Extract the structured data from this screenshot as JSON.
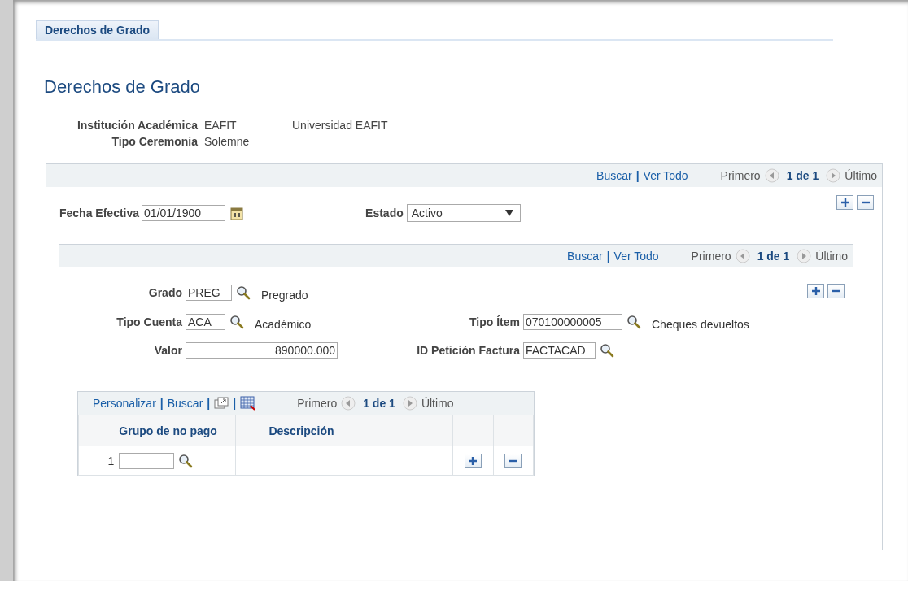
{
  "tab": {
    "label": "Derechos de Grado",
    "selected": true
  },
  "page_title": "Derechos de Grado",
  "header_fields": [
    {
      "label": "Institución Académica",
      "value": "EAFIT",
      "description": "Universidad EAFIT"
    },
    {
      "label": "Tipo Ceremonia",
      "value": "Solemne"
    }
  ],
  "outer_section": {
    "nav": {
      "links": [
        "Buscar",
        "Ver Todo"
      ],
      "separator": "|",
      "first": "Primero",
      "count": "1 de 1",
      "last": "Último"
    },
    "effective_date": {
      "label": "Fecha Efectiva",
      "value": "01/01/1900"
    },
    "status": {
      "label": "Estado",
      "value": "Activo"
    }
  },
  "inner_section": {
    "nav": {
      "links": [
        "Buscar",
        "Ver Todo"
      ],
      "separator": "|",
      "first": "Primero",
      "count": "1 de 1",
      "last": "Último"
    },
    "field_rows": [
      [
        {
          "label": "Grado",
          "value": "PREG",
          "kind": "lookup",
          "description": "Pregrado"
        }
      ],
      [
        {
          "label": "Tipo Cuenta",
          "value": "ACA",
          "kind": "lookup",
          "description": "Académico"
        },
        {
          "label": "Tipo Ítem",
          "value": "070100000005",
          "kind": "lookup",
          "description": "Cheques devueltos"
        }
      ],
      [
        {
          "label": "Valor",
          "value": "890000.000",
          "kind": "number"
        },
        {
          "label": "ID Petición Factura",
          "value": "FACTACAD",
          "kind": "lookup"
        }
      ]
    ]
  },
  "grid": {
    "toolbar": {
      "links": [
        "Personalizar",
        "Buscar"
      ],
      "separator": "|",
      "first": "Primero",
      "count": "1 de 1",
      "last": "Último"
    },
    "columns": [
      "Grupo de no pago",
      "Descripción"
    ],
    "rows": [
      {
        "number": "1"
      }
    ]
  }
}
